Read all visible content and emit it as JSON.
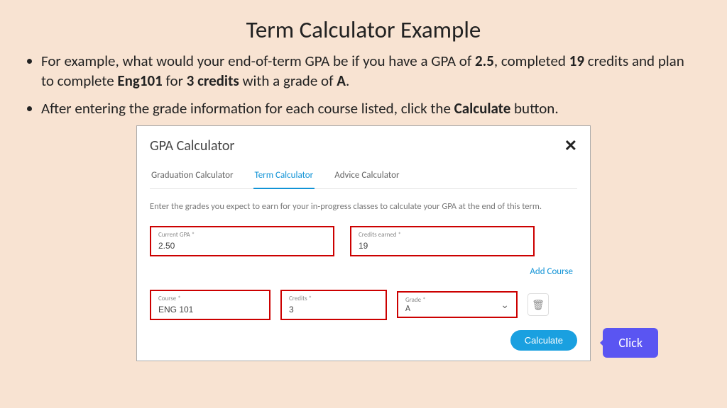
{
  "title": "Term Calculator Example",
  "bullets": {
    "b1_pre": "For example, what would your end-of-term GPA be if you have a GPA of ",
    "b1_gpa": "2.5",
    "b1_mid1": ", completed ",
    "b1_credits": "19",
    "b1_mid2": " credits and plan to complete ",
    "b1_course": "Eng101",
    "b1_mid3": " for ",
    "b1_course_credits": "3 credits",
    "b1_mid4": " with a grade of ",
    "b1_grade": "A",
    "b1_end": ".",
    "b2_pre": "After entering the grade information for each course listed, click the ",
    "b2_btn": "Calculate",
    "b2_end": " button."
  },
  "panel": {
    "title": "GPA Calculator",
    "tabs": {
      "t1": "Graduation Calculator",
      "t2": "Term Calculator",
      "t3": "Advice Calculator"
    },
    "instructions": "Enter the grades you expect to earn for your in-progress classes to calculate your GPA at the end of this term.",
    "fields": {
      "current_gpa_label": "Current GPA *",
      "current_gpa_value": "2.50",
      "credits_earned_label": "Credits earned *",
      "credits_earned_value": "19",
      "course_label": "Course *",
      "course_value": "ENG 101",
      "credits_label": "Credits *",
      "credits_value": "3",
      "grade_label": "Grade *",
      "grade_value": "A"
    },
    "add_course": "Add Course",
    "calculate": "Calculate"
  },
  "callout": "Click"
}
